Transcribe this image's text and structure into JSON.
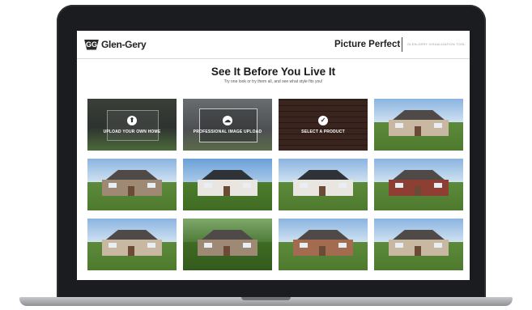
{
  "header": {
    "brand": "Glen-Gery",
    "brand_mark": "GG",
    "product_title": "Picture Perfect",
    "tagline": "GLEN-GERY VISUALIZATION TOOL"
  },
  "hero": {
    "title": "See It Before You Live It",
    "subtitle": "Try one look or try them all, and see what style fits you!"
  },
  "tiles": [
    {
      "kind": "action",
      "label": "UPLOAD YOUR OWN HOME",
      "icon": "upload-icon",
      "glyph": "⬆"
    },
    {
      "kind": "action",
      "label": "PROFESSIONAL IMAGE UPLOAD",
      "icon": "cloud-upload-icon",
      "glyph": "☁"
    },
    {
      "kind": "action",
      "label": "SELECT A PRODUCT",
      "icon": "check-icon",
      "glyph": "✓"
    }
  ],
  "colors": {
    "accent": "#1e1e1e",
    "screen_bg": "#ffffff",
    "laptop_frame": "#1b1c1f"
  }
}
